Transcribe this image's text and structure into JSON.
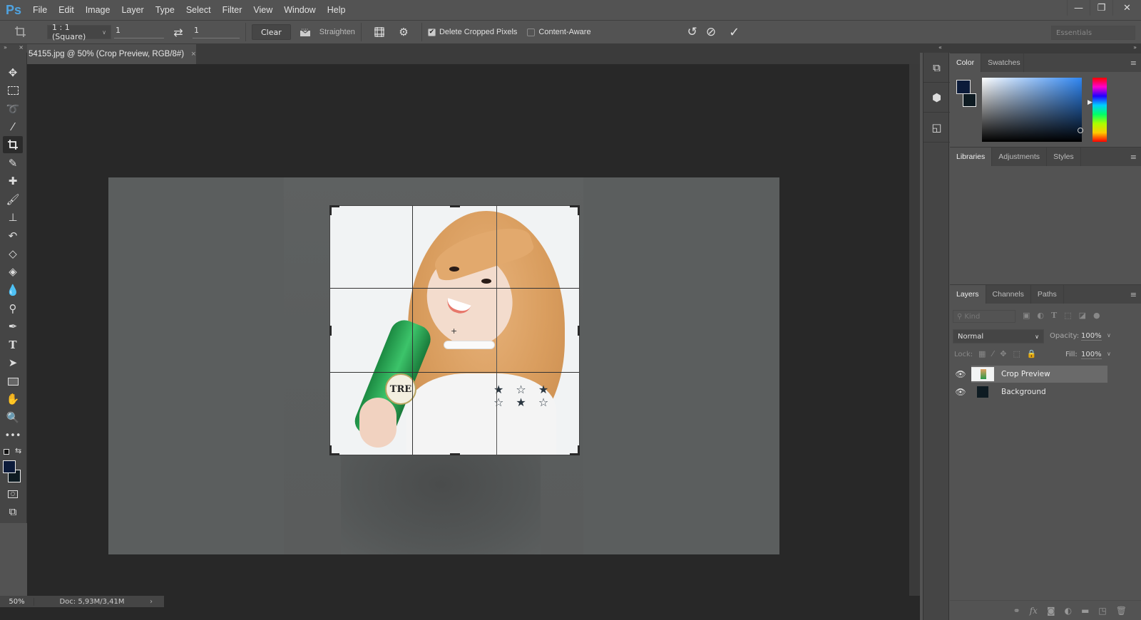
{
  "app": {
    "logo": "Ps"
  },
  "menu": [
    "File",
    "Edit",
    "Image",
    "Layer",
    "Type",
    "Select",
    "Filter",
    "View",
    "Window",
    "Help"
  ],
  "window_controls": {
    "minimize": "—",
    "restore": "❐",
    "close": "✕"
  },
  "options_bar": {
    "ratio_preset": "1 : 1 (Square)",
    "width_value": "1",
    "swap_icon": "⇄",
    "height_value": "1",
    "clear_label": "Clear",
    "straighten_label": "Straighten",
    "delete_cropped_label": "Delete Cropped Pixels",
    "delete_cropped_checked": true,
    "content_aware_label": "Content-Aware",
    "content_aware_checked": false,
    "workspace": "Essentials"
  },
  "document": {
    "tab_title": "54155.jpg @ 50% (Crop Preview, RGB/8#)",
    "close": "×"
  },
  "status": {
    "zoom": "50%",
    "doc_info": "Doc: 5,93M/3,41M",
    "arrow": "›"
  },
  "tools": [
    "move",
    "rectangular-marquee",
    "lasso",
    "magic-wand",
    "crop",
    "eyedropper",
    "healing-brush",
    "brush",
    "clone-stamp",
    "history-brush",
    "eraser",
    "paint-bucket",
    "blur",
    "dodge",
    "pen",
    "type",
    "path-selection",
    "rectangle",
    "hand",
    "zoom",
    "more-tools"
  ],
  "colors": {
    "foreground": "#0c1b3a",
    "background": "#0e1b22",
    "accent": "#4fa3e0"
  },
  "panels": {
    "color_group": {
      "tabs": [
        "Color",
        "Swatches"
      ],
      "active": 0
    },
    "libraries_group": {
      "tabs": [
        "Libraries",
        "Adjustments",
        "Styles"
      ],
      "active": 0
    },
    "layers_group": {
      "tabs": [
        "Layers",
        "Channels",
        "Paths"
      ],
      "active": 0,
      "filter_placeholder": "Kind",
      "blend_mode": "Normal",
      "opacity_label": "Opacity:",
      "opacity_value": "100%",
      "lock_label": "Lock:",
      "fill_label": "Fill:",
      "fill_value": "100%",
      "layers": [
        {
          "name": "Crop Preview",
          "visible": true,
          "selected": true
        },
        {
          "name": "Background",
          "visible": true,
          "selected": false
        }
      ]
    }
  }
}
